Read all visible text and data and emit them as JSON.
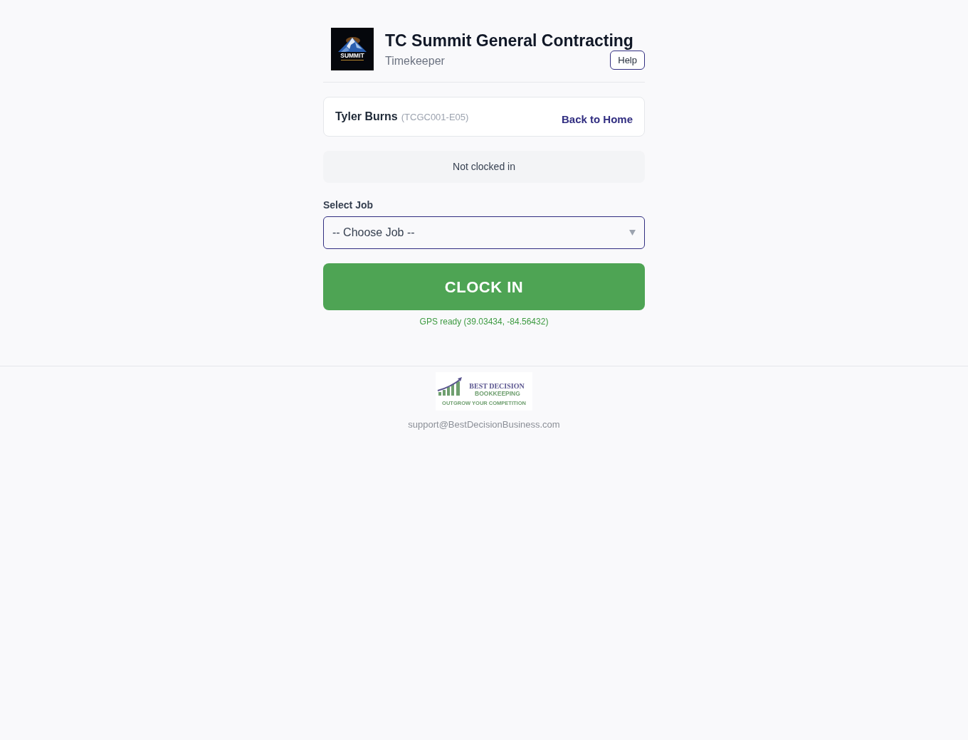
{
  "header": {
    "logo_text": "SUMMIT",
    "title": "TC Summit General Contracting",
    "subtitle": "Timekeeper",
    "help_button": "Help"
  },
  "employee": {
    "name": "Tyler Burns",
    "code": "(TCGC001-E05)",
    "back_link": "Back to Home"
  },
  "status": {
    "text": "Not clocked in"
  },
  "job_select": {
    "label": "Select Job",
    "value": "-- Choose Job --"
  },
  "clock_button": {
    "label": "CLOCK IN"
  },
  "gps": {
    "text": "GPS ready (39.03434, -84.56432)"
  },
  "footer": {
    "logo": {
      "line_1": "BEST DECISION",
      "line_2": "BOOKKEEPING",
      "tagline": "OUTGROW YOUR COMPETITION"
    },
    "email": "support@BestDecisionBusiness.com"
  }
}
